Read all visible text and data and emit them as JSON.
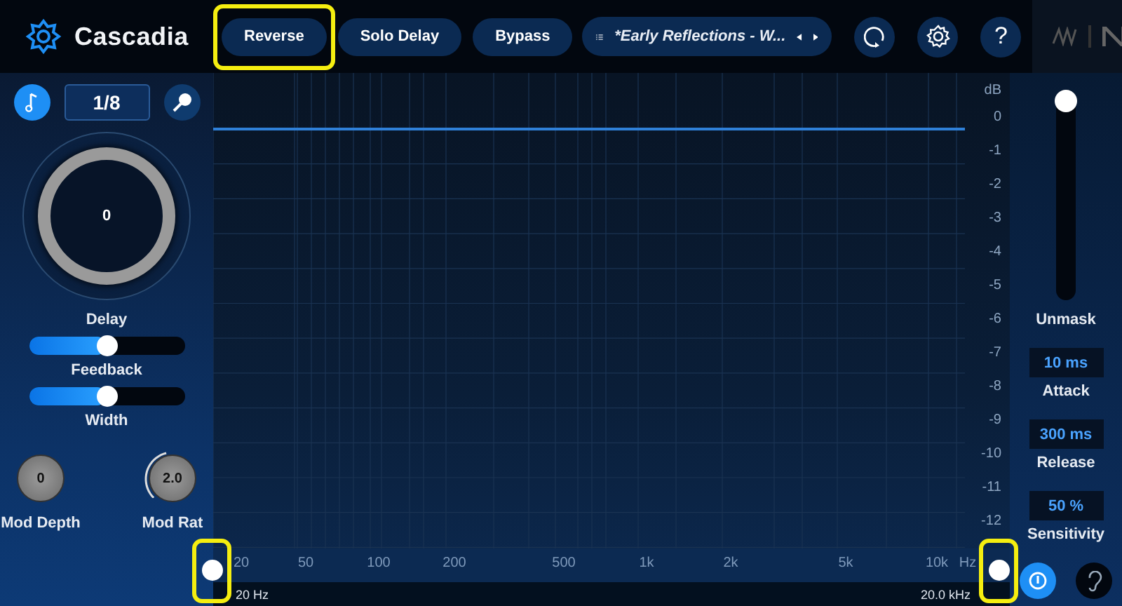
{
  "app": {
    "title": "Cascadia"
  },
  "toolbar": {
    "buttons": [
      {
        "label": "Reverse",
        "highlighted": true
      },
      {
        "label": "Solo Delay",
        "highlighted": false
      },
      {
        "label": "Bypass",
        "highlighted": false
      }
    ],
    "preset": "*Early Reflections - W...",
    "help_label": "?"
  },
  "left_panel": {
    "sync": {
      "on": true
    },
    "division": "1/8",
    "delay": {
      "value": "0",
      "label": "Delay"
    },
    "sliders": [
      {
        "label": "Feedback",
        "level": 0.5
      },
      {
        "label": "Width",
        "level": 0.5
      }
    ],
    "mod_knobs": [
      {
        "value": "0",
        "label": "Mod Depth"
      },
      {
        "value": "2.0",
        "label": "Mod Rat",
        "level": 0.45
      }
    ]
  },
  "graph": {
    "db_unit": "dB",
    "db_ticks": [
      "0",
      "-1",
      "-2",
      "-3",
      "-4",
      "-5",
      "-6",
      "-7",
      "-8",
      "-9",
      "-10",
      "-11",
      "-12"
    ],
    "freq_ticks": [
      "20",
      "50",
      "100",
      "200",
      "500",
      "1k",
      "2k",
      "5k",
      "10k",
      "Hz"
    ],
    "range": {
      "low": "20 Hz",
      "high": "20.0 kHz",
      "low_highlighted": true,
      "high_highlighted": true
    }
  },
  "right_panel": {
    "unmask": {
      "label": "Unmask",
      "level": 1
    },
    "params": [
      {
        "value": "10 ms",
        "label": "Attack"
      },
      {
        "value": "300 ms",
        "label": "Release"
      },
      {
        "value": "50 %",
        "label": "Sensitivity"
      }
    ],
    "power": {
      "on": true
    },
    "listen": {
      "on": false
    }
  }
}
